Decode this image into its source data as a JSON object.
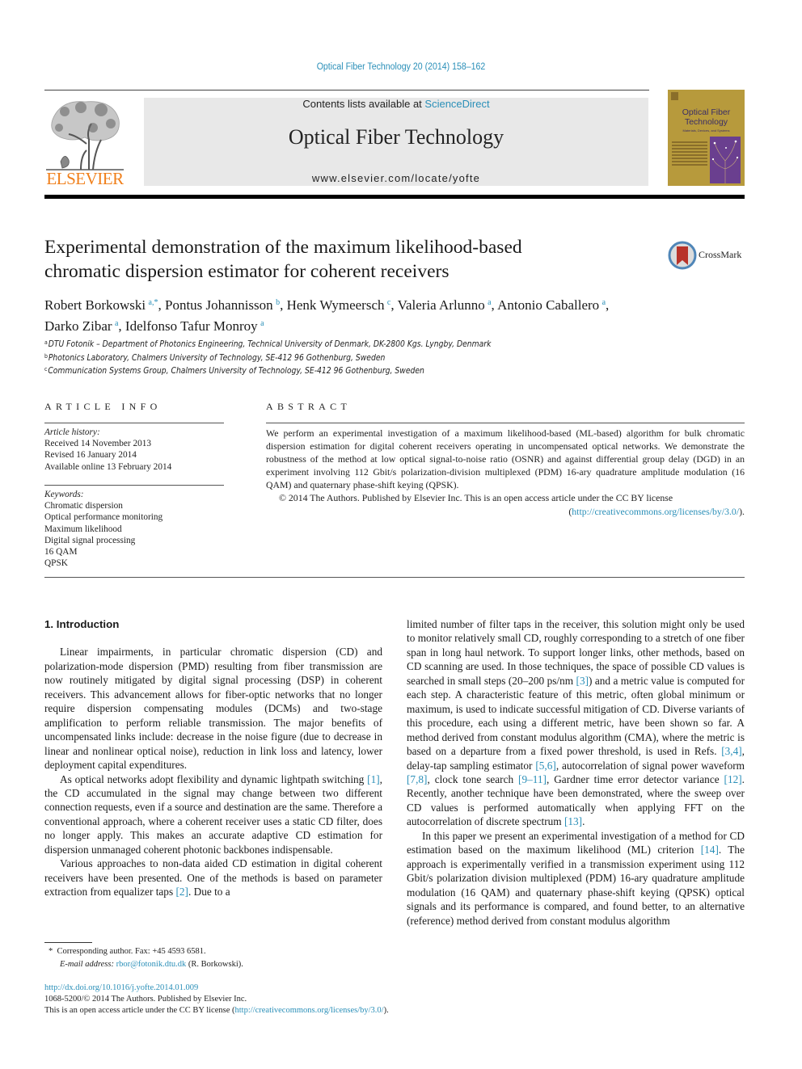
{
  "header": {
    "journal_reference": "Optical Fiber Technology 20 (2014) 158–162",
    "contents_prefix": "Contents lists available at ",
    "contents_link": "ScienceDirect",
    "journal_title": "Optical Fiber Technology",
    "journal_url": "www.elsevier.com/locate/yofte",
    "publisher_logo_text": "ELSEVIER",
    "cover": {
      "title_line1": "Optical Fiber",
      "title_line2": "Technology",
      "subtitle": "Materials, Devices, and Systems"
    },
    "crossmark_label": "CrossMark"
  },
  "article": {
    "title_line1": "Experimental demonstration of the maximum likelihood-based",
    "title_line2": "chromatic dispersion estimator for coherent receivers",
    "authors": [
      {
        "name": "Robert Borkowski",
        "aff": "a,*"
      },
      {
        "name": "Pontus Johannisson",
        "aff": "b"
      },
      {
        "name": "Henk Wymeersch",
        "aff": "c"
      },
      {
        "name": "Valeria Arlunno",
        "aff": "a"
      },
      {
        "name": "Antonio Caballero",
        "aff": "a"
      },
      {
        "name": "Darko Zibar",
        "aff": "a"
      },
      {
        "name": "Idelfonso Tafur Monroy",
        "aff": "a"
      }
    ],
    "affiliations": [
      {
        "key": "a",
        "text": "DTU Fotonik – Department of Photonics Engineering, Technical University of Denmark, DK-2800 Kgs. Lyngby, Denmark"
      },
      {
        "key": "b",
        "text": "Photonics Laboratory, Chalmers University of Technology, SE-412 96 Gothenburg, Sweden"
      },
      {
        "key": "c",
        "text": "Communication Systems Group, Chalmers University of Technology, SE-412 96 Gothenburg, Sweden"
      }
    ]
  },
  "article_info": {
    "heading": "ARTICLE INFO",
    "history_label": "Article history:",
    "history": [
      "Received 14 November 2013",
      "Revised 16 January 2014",
      "Available online 13 February 2014"
    ],
    "keywords_label": "Keywords:",
    "keywords": [
      "Chromatic dispersion",
      "Optical performance monitoring",
      "Maximum likelihood",
      "Digital signal processing",
      "16 QAM",
      "QPSK"
    ]
  },
  "abstract": {
    "heading": "ABSTRACT",
    "text": "We perform an experimental investigation of a maximum likelihood-based (ML-based) algorithm for bulk chromatic dispersion estimation for digital coherent receivers operating in uncompensated optical networks. We demonstrate the robustness of the method at low optical signal-to-noise ratio (OSNR) and against differential group delay (DGD) in an experiment involving 112 Gbit/s polarization-division multiplexed (PDM) 16-ary quadrature amplitude modulation (16 QAM) and quaternary phase-shift keying (QPSK).",
    "license_text": "© 2014 The Authors. Published by Elsevier Inc. This is an open access article under the CC BY license",
    "license_link": "http://creativecommons.org/licenses/by/3.0/"
  },
  "body": {
    "section_heading": "1. Introduction",
    "col1": {
      "p1": "Linear impairments, in particular chromatic dispersion (CD) and polarization-mode dispersion (PMD) resulting from fiber transmission are now routinely mitigated by digital signal processing (DSP) in coherent receivers. This advancement allows for fiber-optic networks that no longer require dispersion compensating modules (DCMs) and two-stage amplification to perform reliable transmission. The major benefits of uncompensated links include: decrease in the noise figure (due to decrease in linear and nonlinear optical noise), reduction in link loss and latency, lower deployment capital expenditures.",
      "p2_a": "As optical networks adopt flexibility and dynamic lightpath switching ",
      "p2_ref1": "[1]",
      "p2_b": ", the CD accumulated in the signal may change between two different connection requests, even if a source and destination are the same. Therefore a conventional approach, where a coherent receiver uses a static CD filter, does no longer apply. This makes an accurate adaptive CD estimation for dispersion unmanaged coherent photonic backbones indispensable.",
      "p3_a": "Various approaches to non-data aided CD estimation in digital coherent receivers have been presented. One of the methods is based on parameter extraction from equalizer taps ",
      "p3_ref2": "[2]",
      "p3_b": ". Due to a"
    },
    "col2": {
      "p1_a": "limited number of filter taps in the receiver, this solution might only be used to monitor relatively small CD, roughly corresponding to a stretch of one fiber span in long haul network. To support longer links, other methods, based on CD scanning are used. In those techniques, the space of possible CD values is searched in small steps (20–200 ps/nm ",
      "ref3": "[3]",
      "p1_b": ") and a metric value is computed for each step. A characteristic feature of this metric, often global minimum or maximum, is used to indicate successful mitigation of CD. Diverse variants of this procedure, each using a different metric, have been shown so far. A method derived from constant modulus algorithm (CMA), where the metric is based on a departure from a fixed power threshold, is used in Refs. ",
      "ref34": "[3,4]",
      "p1_c": ", delay-tap sampling estimator ",
      "ref56": "[5,6]",
      "p1_d": ", autocorrelation of signal power waveform ",
      "ref78": "[7,8]",
      "p1_e": ", clock tone search ",
      "ref911": "[9–11]",
      "p1_f": ", Gardner time error detector variance ",
      "ref12": "[12]",
      "p1_g": ". Recently, another technique have been demonstrated, where the sweep over CD values is performed automatically when applying FFT on the autocorrelation of discrete spectrum ",
      "ref13": "[13]",
      "p1_h": ".",
      "p2_a": "In this paper we present an experimental investigation of a method for CD estimation based on the maximum likelihood (ML) criterion ",
      "ref14": "[14]",
      "p2_b": ". The approach is experimentally verified in a transmission experiment using 112 Gbit/s polarization division multiplexed (PDM) 16-ary quadrature amplitude modulation (16 QAM) and quaternary phase-shift keying (QPSK) optical signals and its performance is compared, and found better, to an alternative (reference) method derived from constant modulus algorithm"
    }
  },
  "footnote": {
    "marker": "*",
    "corresponding": "Corresponding author. Fax: +45 4593 6581.",
    "email_label": "E-mail address:",
    "email": "rbor@fotonik.dtu.dk",
    "email_suffix": " (R. Borkowski)."
  },
  "bottom": {
    "doi": "http://dx.doi.org/10.1016/j.yofte.2014.01.009",
    "issn_line": "1068-5200/© 2014 The Authors. Published by Elsevier Inc.",
    "license_prefix": "This is an open access article under the CC BY license (",
    "license_link": "http://creativecommons.org/licenses/by/3.0/",
    "license_suffix": ")."
  }
}
